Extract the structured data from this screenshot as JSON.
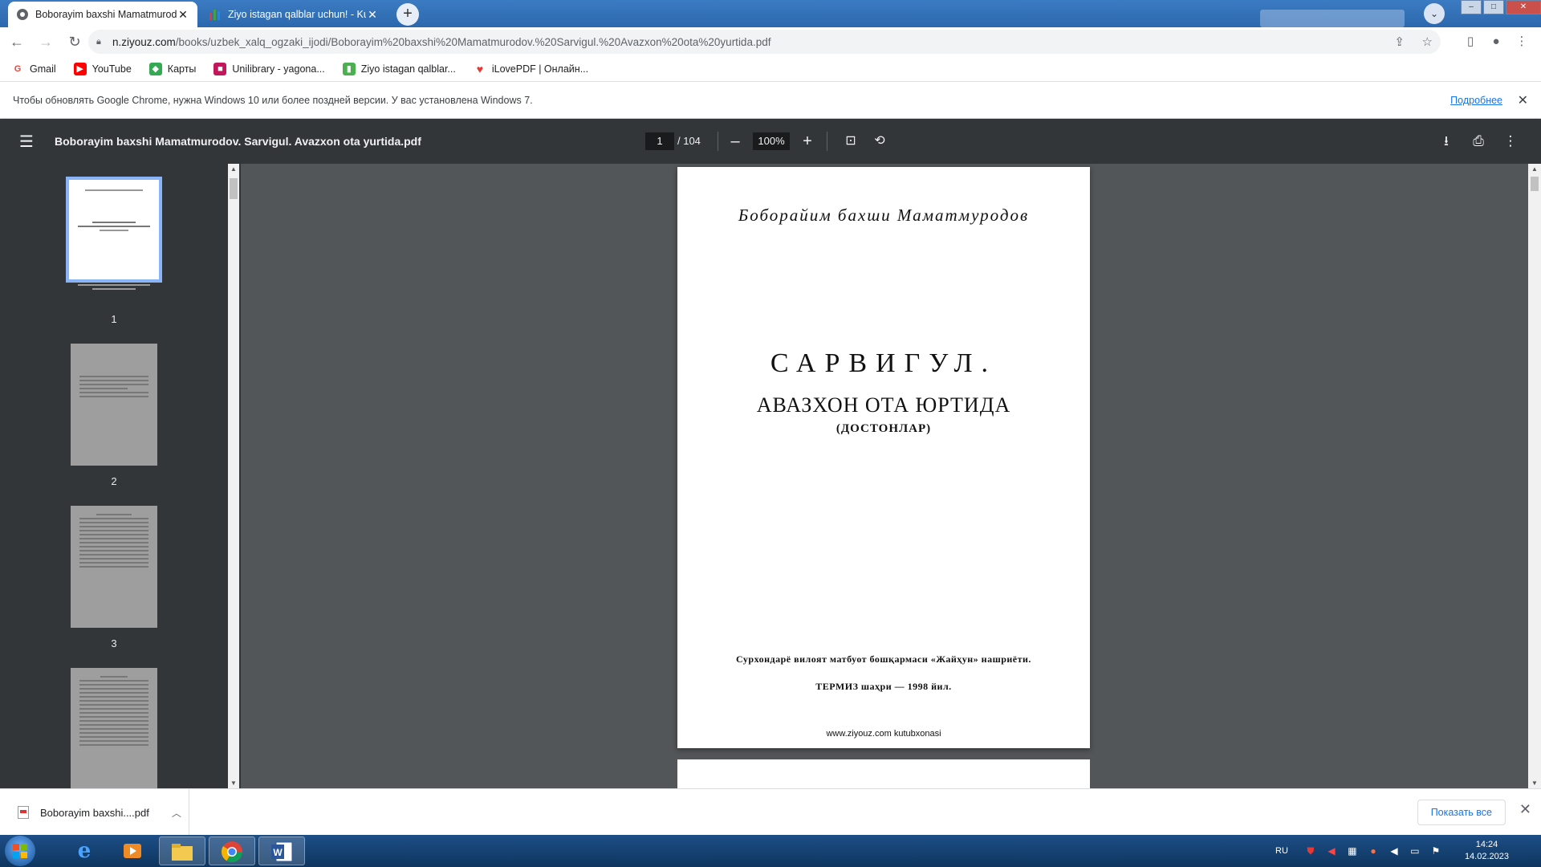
{
  "browser": {
    "tabs": [
      {
        "title": "Boborayim baxshi Mamatmurodov",
        "active": true
      },
      {
        "title": "Ziyo istagan qalblar uchun! - Kutub",
        "active": false
      }
    ],
    "new_tab": "+",
    "url_host": "n.ziyouz.com",
    "url_path": "/books/uzbek_xalq_ogzaki_ijodi/Boborayim%20baxshi%20Mamatmurodov.%20Sarvigul.%20Avazxon%20ota%20yurtida.pdf",
    "bookmarks": [
      {
        "label": "Gmail",
        "color": "#ea4335",
        "glyph": "G"
      },
      {
        "label": "YouTube",
        "color": "#ff0000",
        "glyph": "▶"
      },
      {
        "label": "Карты",
        "color": "#34a853",
        "glyph": "◆"
      },
      {
        "label": "Unilibrary - yagona...",
        "color": "#c2185b",
        "glyph": "■"
      },
      {
        "label": "Ziyo istagan qalblar...",
        "color": "#4caf50",
        "glyph": "▮"
      },
      {
        "label": "iLovePDF | Онлайн...",
        "color": "#e53935",
        "glyph": "♥"
      }
    ],
    "infobar": {
      "message": "Чтобы обновлять Google Chrome, нужна Windows 10 или более поздней версии. У вас установлена Windows 7.",
      "link": "Подробнее"
    }
  },
  "pdf": {
    "title": "Boborayim baxshi Mamatmurodov. Sarvigul. Avazxon ota yurtida.pdf",
    "current_page": "1",
    "total_pages": "/ 104",
    "zoom": "100%",
    "thumbnails": [
      {
        "number": "1",
        "selected": true
      },
      {
        "number": "2",
        "selected": false
      },
      {
        "number": "3",
        "selected": false
      }
    ],
    "page1": {
      "author": "Боборайим бахши Маматмуродов",
      "title": "САРВИГУЛ.",
      "subtitle": "АВАЗХОН ОТА ЮРТИДА",
      "genre": "(ДОСТОНЛАР)",
      "publisher": "Сурхондарё вилоят матбуот бошқармаси «Жайҳун» нашриёти.",
      "city_year": "ТЕРМИЗ шаҳри — 1998 йил.",
      "website": "www.ziyouz.com kutubxonasi"
    }
  },
  "downloads": {
    "file": "Boborayim baxshi....pdf",
    "show_all": "Показать все"
  },
  "taskbar": {
    "language": "RU",
    "time": "14:24",
    "date": "14.02.2023"
  }
}
